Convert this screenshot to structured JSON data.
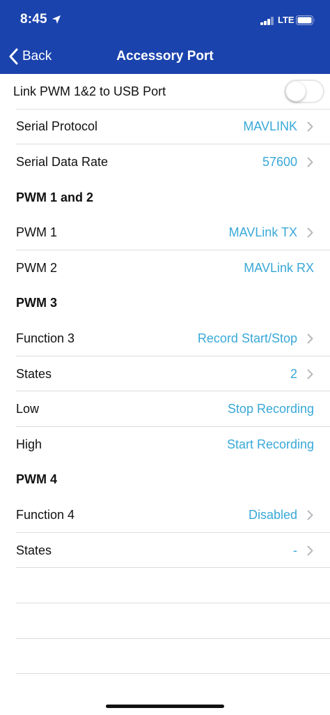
{
  "status": {
    "time": "8:45",
    "network": "LTE",
    "icons": [
      "location-arrow-icon",
      "signal-bars-icon",
      "battery-icon"
    ]
  },
  "nav": {
    "back_label": "Back",
    "title": "Accessory Port"
  },
  "link_row": {
    "label": "Link PWM 1&2 to USB Port",
    "toggle_on": false
  },
  "rows": {
    "serial_protocol": {
      "label": "Serial Protocol",
      "value": "MAVLINK"
    },
    "serial_data_rate": {
      "label": "Serial Data Rate",
      "value": "57600"
    },
    "section_pwm12": {
      "label": "PWM 1 and 2"
    },
    "pwm1": {
      "label": "PWM 1",
      "value": "MAVLink TX"
    },
    "pwm2": {
      "label": "PWM 2",
      "value": "MAVLink RX"
    },
    "section_pwm3": {
      "label": "PWM 3"
    },
    "function3": {
      "label": "Function 3",
      "value": "Record Start/Stop"
    },
    "states3": {
      "label": "States",
      "value": "2"
    },
    "low": {
      "label": "Low",
      "value": "Stop Recording"
    },
    "high": {
      "label": "High",
      "value": "Start Recording"
    },
    "section_pwm4": {
      "label": "PWM 4"
    },
    "function4": {
      "label": "Function 4",
      "value": "Disabled"
    },
    "states4": {
      "label": "States",
      "value": "-"
    }
  },
  "colors": {
    "header": "#1b43ad",
    "value_text": "#38a8d8",
    "separator": "#dcdcdc"
  }
}
